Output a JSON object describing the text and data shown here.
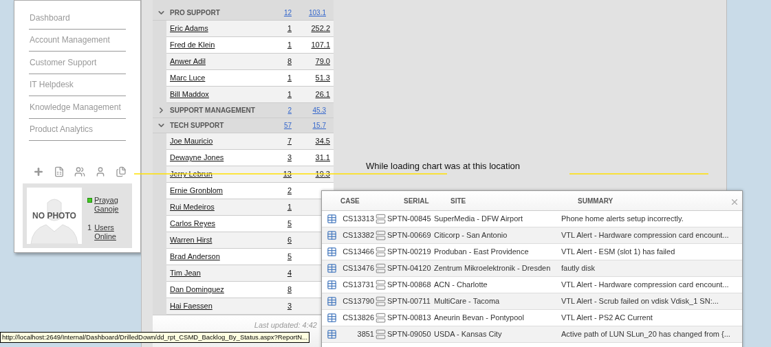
{
  "sidebar": {
    "items": [
      {
        "label": "Dashboard"
      },
      {
        "label": "Account Management"
      },
      {
        "label": "Customer Support"
      },
      {
        "label": "IT Helpdesk"
      },
      {
        "label": "Knowledge Management"
      },
      {
        "label": "Product Analytics"
      }
    ],
    "profile": {
      "photo_text": "NO PHOTO",
      "name": "Prayag Ganoje",
      "online": true,
      "users_count": "1",
      "users_label": "Users Online"
    }
  },
  "table": {
    "groups": [
      {
        "name": "PRO SUPPORT",
        "count": "12",
        "value": "103.1",
        "expanded": true,
        "rows": [
          {
            "name": "Eric Adams",
            "count": "1",
            "value": "252.2"
          },
          {
            "name": "Fred de Klein",
            "count": "1",
            "value": "107.1"
          },
          {
            "name": "Anwer Adil",
            "count": "8",
            "value": "79.0"
          },
          {
            "name": "Marc Luce",
            "count": "1",
            "value": "51.3"
          },
          {
            "name": "Bill Maddox",
            "count": "1",
            "value": "26.1"
          }
        ]
      },
      {
        "name": "SUPPORT MANAGEMENT",
        "count": "2",
        "value": "45.3",
        "expanded": false
      },
      {
        "name": "TECH SUPPORT",
        "count": "57",
        "value": "15.7",
        "expanded": true,
        "rows": [
          {
            "name": "Joe Mauricio",
            "count": "7",
            "value": "34.5"
          },
          {
            "name": "Dewayne Jones",
            "count": "3",
            "value": "31.1"
          },
          {
            "name": "Jerry Lebrun",
            "count": "13",
            "value": "19.3"
          },
          {
            "name": "Ernie Gronblom",
            "count": "2"
          },
          {
            "name": "Rui Medeiros",
            "count": "1"
          },
          {
            "name": "Carlos Reyes",
            "count": "5"
          },
          {
            "name": "Warren Hirst",
            "count": "6"
          },
          {
            "name": "Brad Anderson",
            "count": "5"
          },
          {
            "name": "Tim Jean",
            "count": "4"
          },
          {
            "name": "Dan Dominguez",
            "count": "8"
          },
          {
            "name": "Hai Faessen",
            "count": "3"
          }
        ]
      }
    ],
    "last_updated": "Last updated: 4:42"
  },
  "annotation": {
    "text": "While loading chart was at this location"
  },
  "popup": {
    "columns": [
      "CASE",
      "SERIAL",
      "SITE",
      "SUMMARY"
    ],
    "rows": [
      {
        "case": "CS13313",
        "serial": "SPTN-00845",
        "site": "SuperMedia - DFW Airport",
        "summary": "Phone home alerts setup incorrectly."
      },
      {
        "case": "CS13382",
        "serial": "SPTN-00669",
        "site": "Citicorp - San Antonio",
        "summary": "VTL Alert - Hardware compression card encount..."
      },
      {
        "case": "CS13466",
        "serial": "SPTN-00219",
        "site": "Produban - East Providence",
        "summary": "VTL Alert - ESM (slot 1) has failed"
      },
      {
        "case": "CS13476",
        "serial": "SPTN-04120",
        "site": "Zentrum Mikroelektronik - Dresden",
        "summary": "fautly disk"
      },
      {
        "case": "CS13731",
        "serial": "SPTN-00868",
        "site": "ACN - Charlotte",
        "summary": "VTL Alert - Hardware compression card encount..."
      },
      {
        "case": "CS13790",
        "serial": "SPTN-00711",
        "site": "MultiCare - Tacoma",
        "summary": "VTL Alert - Scrub failed on vdisk Vdisk_1 SN:..."
      },
      {
        "case": "CS13826",
        "serial": "SPTN-00813",
        "site": "Aneurin Bevan - Pontypool",
        "summary": "VTL Alert - PS2 AC Current"
      },
      {
        "case": "3851",
        "serial": "SPTN-09050",
        "site": "USDA - Kansas City",
        "summary": "Active path of LUN SLun_20 has changed from {..."
      }
    ]
  },
  "status_tooltip": "http://localhost:2649/Internal/Dashboard/DrilledDown/dd_rpt_CSMD_Backlog_By_Status.aspx?ReportN..."
}
